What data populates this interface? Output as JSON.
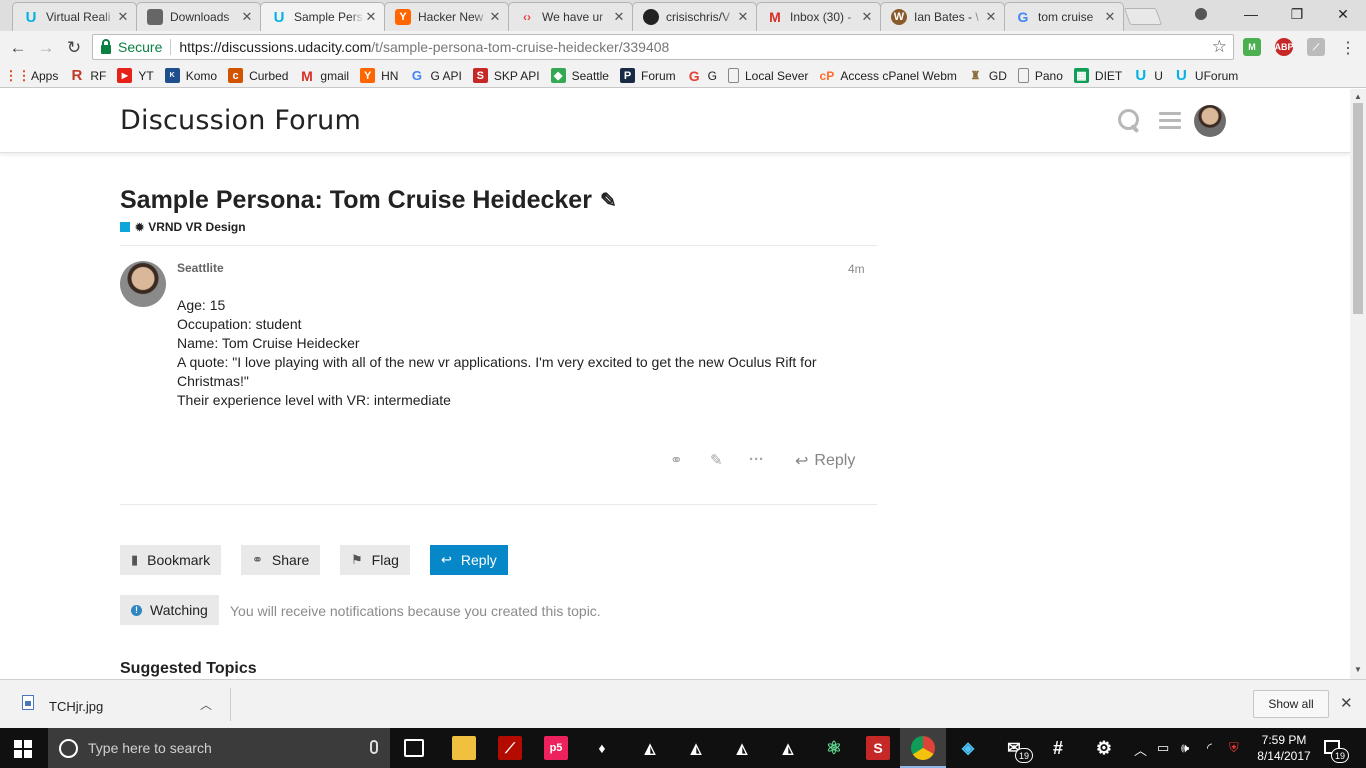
{
  "browser": {
    "tabs": [
      {
        "title": "Virtual Reali",
        "icon": "udacity-icon",
        "color": "#02b3e4"
      },
      {
        "title": "Downloads",
        "icon": "box-icon",
        "color": "#666666"
      },
      {
        "title": "Sample Pers",
        "icon": "udacity-icon",
        "color": "#02b3e4"
      },
      {
        "title": "Hacker New",
        "icon": "y-icon",
        "color": "#ff6600"
      },
      {
        "title": "We have ur",
        "icon": "code-icon",
        "color": "#e8453c"
      },
      {
        "title": "crisischris/V",
        "icon": "github-icon",
        "color": "#222222"
      },
      {
        "title": "Inbox (30) -",
        "icon": "gmail-icon",
        "color": "#d93025"
      },
      {
        "title": "Ian Bates - \\",
        "icon": "wordpress-icon",
        "color": "#8a5a2b"
      },
      {
        "title": "tom cruise",
        "icon": "google-icon",
        "color": "#4285f4"
      }
    ],
    "secure_label": "Secure",
    "url_host": "https://discussions.udacity.com",
    "url_path": "/t/sample-persona-tom-cruise-heidecker/339408",
    "bookmarks": [
      {
        "label": "Apps",
        "icon": "apps-grid-icon",
        "color": "#4a4a4a"
      },
      {
        "label": "RF",
        "icon": "r-icon",
        "color": "#c0392b"
      },
      {
        "label": "YT",
        "icon": "youtube-icon",
        "color": "#e62117"
      },
      {
        "label": "Komo",
        "icon": "komo-icon",
        "color": "#1f4e8c"
      },
      {
        "label": "Curbed",
        "icon": "curbed-icon",
        "color": "#d35400"
      },
      {
        "label": "gmail",
        "icon": "gmail-icon",
        "color": "#d93025"
      },
      {
        "label": "HN",
        "icon": "y-icon",
        "color": "#ff6600"
      },
      {
        "label": "G API",
        "icon": "google-icon",
        "color": "#4285f4"
      },
      {
        "label": "SKP API",
        "icon": "skp-icon",
        "color": "#c62828"
      },
      {
        "label": "Seattle",
        "icon": "maps-icon",
        "color": "#34a853"
      },
      {
        "label": "Forum",
        "icon": "p-icon",
        "color": "#1a2a44"
      },
      {
        "label": "G",
        "icon": "g-icon",
        "color": "#e34133"
      },
      {
        "label": "Local Sever",
        "icon": "page-icon",
        "color": "#777777"
      },
      {
        "label": "Access cPanel Webm",
        "icon": "cpanel-icon",
        "color": "#ff6c2c"
      },
      {
        "label": "GD",
        "icon": "gd-icon",
        "color": "#8a6d3b"
      },
      {
        "label": "Pano",
        "icon": "page-icon",
        "color": "#777777"
      },
      {
        "label": "DIET",
        "icon": "sheets-icon",
        "color": "#0f9d58"
      },
      {
        "label": "U",
        "icon": "udacity-icon",
        "color": "#02b3e4"
      },
      {
        "label": "UForum",
        "icon": "udacity-icon",
        "color": "#02b3e4"
      }
    ]
  },
  "forum": {
    "site_title": "Discussion Forum",
    "topic_title": "Sample Persona: Tom Cruise Heidecker",
    "category": "VRND VR Design",
    "category_color": "#0ea5d9",
    "post": {
      "username": "Seattlite",
      "age": "4m",
      "lines": [
        "Age: 15",
        "Occupation: student",
        "Name: Tom Cruise Heidecker",
        "A quote: \"I love playing with all of the new vr applications. I'm very excited to get the new Oculus Rift for Christmas!\"",
        "Their experience level with VR: intermediate"
      ],
      "reply_label": "Reply"
    },
    "buttons": {
      "bookmark": "Bookmark",
      "share": "Share",
      "flag": "Flag",
      "reply": "Reply"
    },
    "notification": {
      "watching_label": "Watching",
      "message": "You will receive notifications because you created this topic."
    },
    "suggested_heading": "Suggested Topics",
    "accent_color": "#0688c8"
  },
  "downloads": {
    "filename": "TCHjr.jpg",
    "show_all": "Show all"
  },
  "taskbar": {
    "search_placeholder": "Type here to search",
    "time": "7:59 PM",
    "date": "8/14/2017",
    "mail_badge": "19",
    "notification_badge": "19"
  }
}
